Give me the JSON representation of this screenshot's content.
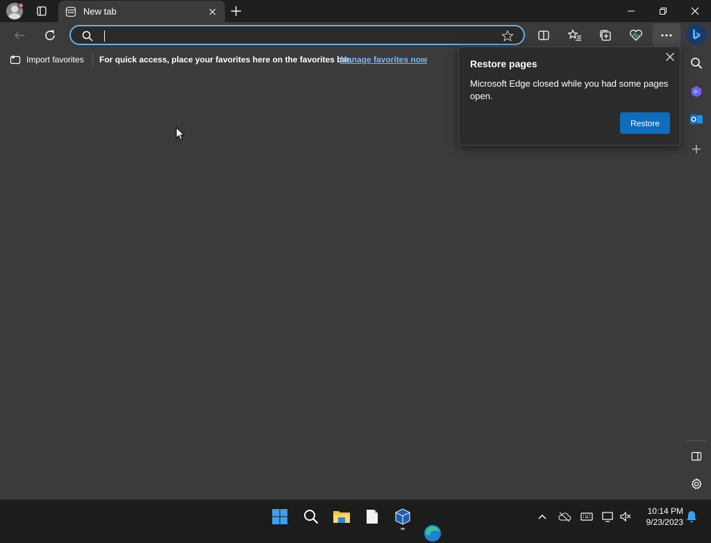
{
  "tab": {
    "title": "New tab"
  },
  "address": {
    "value": "",
    "placeholder": ""
  },
  "favorites_bar": {
    "import_label": "Import favorites",
    "message": "For quick access, place your favorites here on the favorites bar.",
    "manage_link": "Manage favorites now"
  },
  "popup": {
    "title": "Restore pages",
    "body": "Microsoft Edge closed while you had some pages open.",
    "restore_label": "Restore"
  },
  "clock": {
    "time": "10:14 PM",
    "date": "9/23/2023"
  },
  "colors": {
    "accent": "#0f6cbd",
    "link": "#7eb6ef",
    "address_border": "#6ab0e8"
  }
}
